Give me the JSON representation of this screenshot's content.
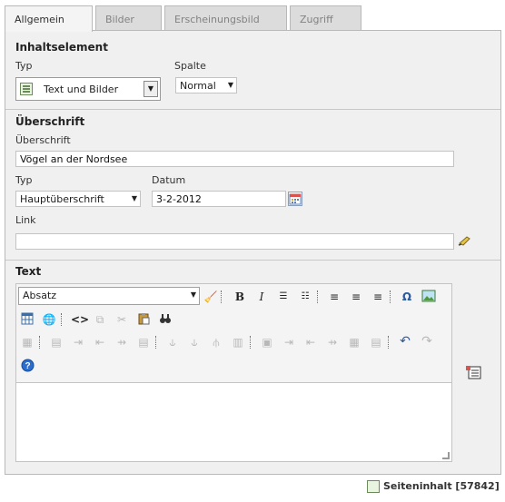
{
  "tabs": [
    "Allgemein",
    "Bilder",
    "Erscheinungsbild",
    "Zugriff"
  ],
  "general": {
    "section_title": "Inhaltselement",
    "type_label": "Typ",
    "type_value": "Text und Bilder",
    "column_label": "Spalte",
    "column_value": "Normal"
  },
  "header": {
    "section_title": "Überschrift",
    "header_label": "Überschrift",
    "header_value": "Vögel an der Nordsee",
    "type_label": "Typ",
    "type_value": "Hauptüberschrift",
    "date_label": "Datum",
    "date_value": "3-2-2012",
    "link_label": "Link",
    "link_value": ""
  },
  "text": {
    "section_title": "Text",
    "block_format": "Absatz",
    "content": ""
  },
  "footer": {
    "label": "Seiteninhalt [57842]"
  },
  "icons": {
    "content_type": "text-image-icon",
    "calendar": "calendar-icon",
    "link_wizard": "link-wizard-icon",
    "fullscreen": "fullscreen-rte-icon",
    "record": "content-record-icon"
  },
  "colors": {
    "panel_bg": "#f0f0f0",
    "border": "#b9b9b9",
    "rte_separator": "#3a78c8"
  }
}
